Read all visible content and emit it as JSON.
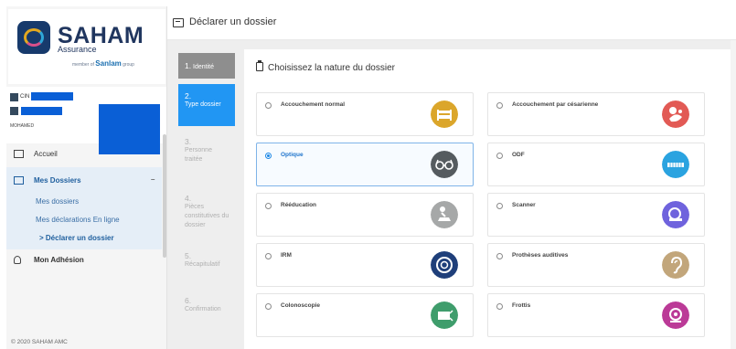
{
  "brand": {
    "name": "SAHAM",
    "sub": "Assurance",
    "group_prefix": "member of",
    "group_name": "Sanlam",
    "group_suffix": "group"
  },
  "user": {
    "line1": "CIN",
    "name": "MOHAMED"
  },
  "sidebar": {
    "items": [
      {
        "label": "Accueil",
        "icon": "monitor-icon"
      },
      {
        "label": "Mes Dossiers",
        "icon": "folder-enter-icon",
        "toggle": "–"
      },
      {
        "label": "Mon Adhésion",
        "icon": "person-icon"
      }
    ],
    "subitems": [
      {
        "label": "Mes dossiers"
      },
      {
        "label": "Mes déclarations En ligne"
      },
      {
        "label": "Déclarer un dossier",
        "prefix": ">"
      }
    ],
    "copyright": "© 2020 SAHAM AMC"
  },
  "header": {
    "title": "Déclarer un dossier"
  },
  "steps": [
    {
      "num": "1.",
      "label": "Identité"
    },
    {
      "num": "2.",
      "label": "Type dossier"
    },
    {
      "num": "3.",
      "label": "Personne traitée"
    },
    {
      "num": "4.",
      "label": "Pièces constitutives du dossier"
    },
    {
      "num": "5.",
      "label": "Récapitulatif"
    },
    {
      "num": "6.",
      "label": "Confirmation"
    }
  ],
  "form": {
    "title": "Choisissez la nature du dossier",
    "options": [
      {
        "label": "Accouchement normal",
        "color": "#dba62b",
        "icon": "bed-icon",
        "selected": false
      },
      {
        "label": "Accouchement par césarienne",
        "color": "#e25a55",
        "icon": "baby-care-icon",
        "selected": false
      },
      {
        "label": "Optique",
        "color": "#555b5f",
        "icon": "glasses-icon",
        "selected": true
      },
      {
        "label": "ODF",
        "color": "#2aa3e0",
        "icon": "teeth-brace-icon",
        "selected": false
      },
      {
        "label": "Rééducation",
        "color": "#a6a8a8",
        "icon": "rehab-icon",
        "selected": false
      },
      {
        "label": "Scanner",
        "color": "#6f63dd",
        "icon": "scanner-icon",
        "selected": false
      },
      {
        "label": "IRM",
        "color": "#1f3f7a",
        "icon": "mri-icon",
        "selected": false
      },
      {
        "label": "Prothèses auditives",
        "color": "#c2a67b",
        "icon": "ear-icon",
        "selected": false
      },
      {
        "label": "Colonoscopie",
        "color": "#3f9d6c",
        "icon": "endoscopy-icon",
        "selected": false
      },
      {
        "label": "Frottis",
        "color": "#bb3a97",
        "icon": "microscope-icon",
        "selected": false
      }
    ]
  }
}
